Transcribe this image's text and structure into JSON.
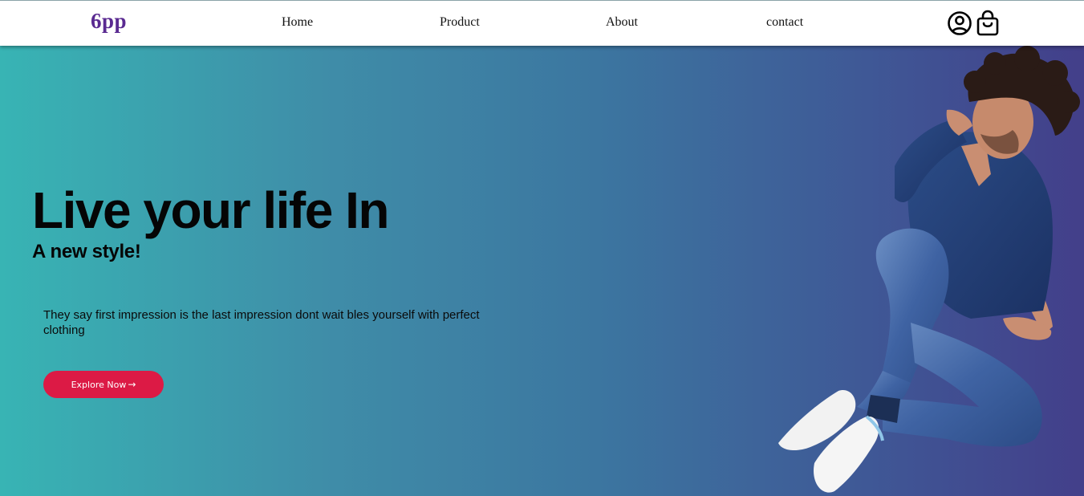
{
  "brand": {
    "logo": "6pp",
    "logo_color": "#5a2a91"
  },
  "nav": {
    "links": [
      {
        "label": "Home"
      },
      {
        "label": "Product"
      },
      {
        "label": "About"
      },
      {
        "label": "contact"
      }
    ],
    "icons": [
      "user-circle-icon",
      "shopping-bag-icon"
    ]
  },
  "hero": {
    "title": "Live your life In",
    "subtitle": "A new style!",
    "text": "They say first impression is the last impression dont wait bles yourself with perfect clothing",
    "cta": {
      "label": "Explore Now",
      "icon": "arrow-right-icon",
      "color": "#dc1a45"
    },
    "gradient": [
      "#38b4b4",
      "#433f8a"
    ],
    "image": "model-photo"
  }
}
